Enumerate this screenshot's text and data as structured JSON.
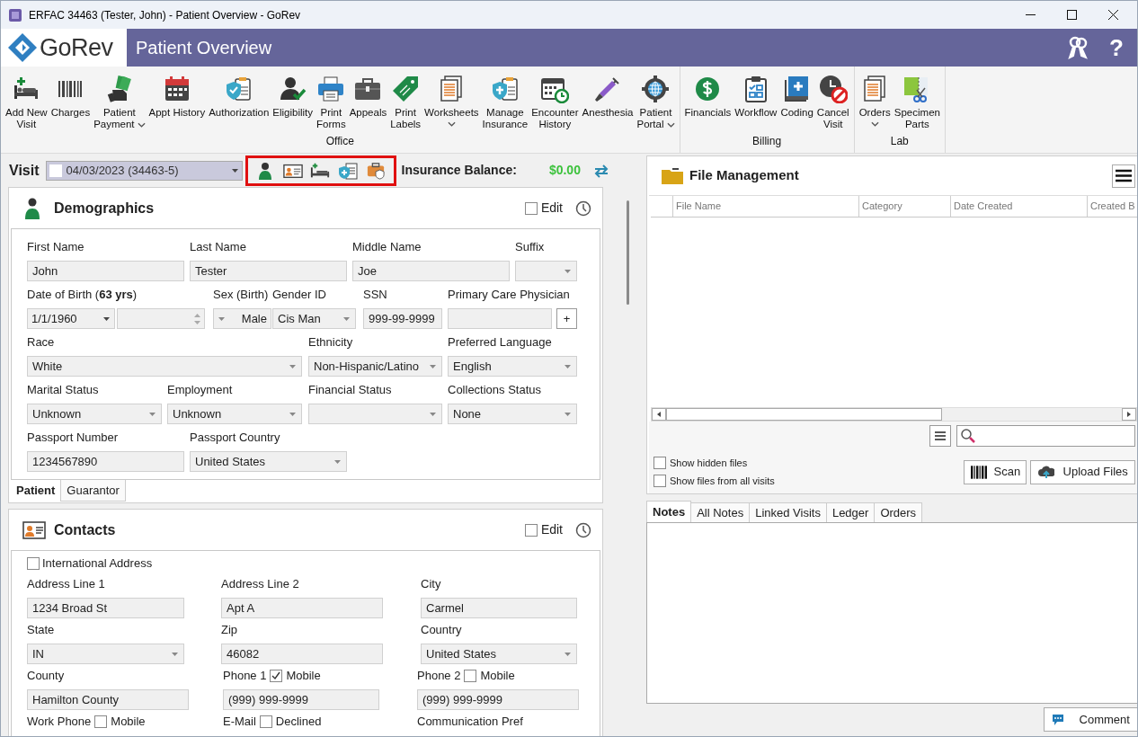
{
  "window": {
    "title": "ERFAC 34463 (Tester, John) - Patient Overview - GoRev"
  },
  "header": {
    "logo": "GoRev",
    "title": "Patient Overview",
    "help": "?"
  },
  "toolbar": {
    "groups": [
      {
        "label": "Office",
        "items": [
          {
            "lines": [
              "Add New",
              "Visit"
            ],
            "dropdown": false
          },
          {
            "lines": [
              "Charges"
            ],
            "dropdown": false
          },
          {
            "lines": [
              "Patient",
              "Payment"
            ],
            "dropdown": true
          },
          {
            "lines": [
              "Appt History"
            ],
            "dropdown": false
          },
          {
            "lines": [
              "Authorization"
            ],
            "dropdown": false
          },
          {
            "lines": [
              "Eligibility"
            ],
            "dropdown": false
          },
          {
            "lines": [
              "Print",
              "Forms"
            ],
            "dropdown": false
          },
          {
            "lines": [
              "Appeals"
            ],
            "dropdown": false
          },
          {
            "lines": [
              "Print",
              "Labels"
            ],
            "dropdown": false
          },
          {
            "lines": [
              "Worksheets"
            ],
            "dropdown": true
          },
          {
            "lines": [
              "Manage",
              "Insurance"
            ],
            "dropdown": false
          },
          {
            "lines": [
              "Encounter",
              "History"
            ],
            "dropdown": false
          },
          {
            "lines": [
              "Anesthesia"
            ],
            "dropdown": false
          },
          {
            "lines": [
              "Patient",
              "Portal"
            ],
            "dropdown": true
          }
        ]
      },
      {
        "label": "Billing",
        "items": [
          {
            "lines": [
              "Financials"
            ],
            "dropdown": false
          },
          {
            "lines": [
              "Workflow"
            ],
            "dropdown": false
          },
          {
            "lines": [
              "Coding"
            ],
            "dropdown": false
          },
          {
            "lines": [
              "Cancel",
              "Visit"
            ],
            "dropdown": false
          }
        ]
      },
      {
        "label": "Lab",
        "items": [
          {
            "lines": [
              "Orders"
            ],
            "dropdown": true
          },
          {
            "lines": [
              "Specimen",
              "Parts"
            ],
            "dropdown": false
          }
        ]
      }
    ]
  },
  "visit": {
    "label": "Visit",
    "value": "04/03/2023 (34463-5)",
    "balance_label": "Insurance Balance:",
    "balance_value": "$0.00"
  },
  "demographics": {
    "title": "Demographics",
    "edit": {
      "label": "Edit",
      "checked": false
    },
    "fields": [
      {
        "label": "First Name",
        "kind": "text",
        "value": "John"
      },
      {
        "label": "Last Name",
        "kind": "text",
        "value": "Tester"
      },
      {
        "label": "Middle Name",
        "kind": "text",
        "value": "Joe"
      },
      {
        "label": "Suffix",
        "kind": "select"
      },
      {
        "label": "Date of Birth (**63 yrs**)",
        "kind": "date",
        "value": "1/1/1960"
      },
      {
        "label": "Sex (Birth)",
        "kind": "select-left",
        "value": "Male"
      },
      {
        "label": "Gender ID",
        "kind": "select",
        "value": "Cis Man"
      },
      {
        "label": "SSN",
        "kind": "text",
        "value": "999-99-9999"
      },
      {
        "label": "Primary Care Physician",
        "kind": "lookup",
        "button": "+"
      },
      {
        "label": "Race",
        "kind": "select",
        "value": "White"
      },
      {
        "label": "Ethnicity",
        "kind": "select",
        "value": "Non-Hispanic/Latino"
      },
      {
        "label": "Preferred Language",
        "kind": "select",
        "value": "English"
      },
      {
        "label": "Marital Status",
        "kind": "select",
        "value": "Unknown"
      },
      {
        "label": "Employment",
        "kind": "select",
        "value": "Unknown"
      },
      {
        "label": "Financial Status",
        "kind": "select"
      },
      {
        "label": "Collections Status",
        "kind": "select",
        "value": "None"
      },
      {
        "label": "Passport Number",
        "kind": "text",
        "value": "1234567890"
      },
      {
        "label": "Passport Country",
        "kind": "select",
        "value": "United States"
      }
    ],
    "tabs": [
      {
        "label": "Patient",
        "selected": true
      },
      {
        "label": "Guarantor",
        "selected": false
      }
    ]
  },
  "contacts": {
    "title": "Contacts",
    "edit": {
      "label": "Edit",
      "checked": false
    },
    "international": {
      "label": "International Address",
      "checked": false
    },
    "fields": [
      {
        "label": "Address Line 1",
        "kind": "text",
        "value": "1234 Broad St"
      },
      {
        "label": "Address Line 2",
        "kind": "text",
        "value": "Apt A"
      },
      {
        "label": "City",
        "kind": "text",
        "value": "Carmel"
      },
      {
        "label": "State",
        "kind": "select",
        "value": "IN"
      },
      {
        "label": "Zip",
        "kind": "text",
        "value": "46082"
      },
      {
        "label": "Country",
        "kind": "select",
        "value": "United States"
      },
      {
        "label": "County",
        "kind": "text",
        "value": "Hamilton County"
      },
      {
        "label": "Phone 1",
        "kind": "text",
        "value": "(999) 999-9999",
        "checkbox": {
          "label": "Mobile",
          "checked": true
        }
      },
      {
        "label": "Phone 2",
        "kind": "text",
        "value": "(999) 999-9999",
        "checkbox": {
          "label": "Mobile",
          "checked": false
        }
      },
      {
        "label": "Work Phone",
        "checkbox": {
          "label": "Mobile",
          "checked": false
        }
      },
      {
        "label": "E-Mail",
        "checkbox": {
          "label": "Declined",
          "checked": false
        }
      },
      {
        "label": "Communication Pref"
      }
    ]
  },
  "file_management": {
    "title": "File Management",
    "columns": [
      "File Name",
      "Category",
      "Date Created",
      "Created B"
    ],
    "options": [
      {
        "label": "Show hidden files",
        "checked": false
      },
      {
        "label": "Show files from all visits",
        "checked": false
      }
    ],
    "buttons": [
      "Scan",
      "Upload Files"
    ]
  },
  "notes": {
    "tabs": [
      {
        "label": "Notes",
        "selected": true
      },
      {
        "label": "All Notes",
        "selected": false
      },
      {
        "label": "Linked Visits",
        "selected": false
      },
      {
        "label": "Ledger",
        "selected": false
      },
      {
        "label": "Orders",
        "selected": false
      }
    ],
    "button": "Comment"
  }
}
